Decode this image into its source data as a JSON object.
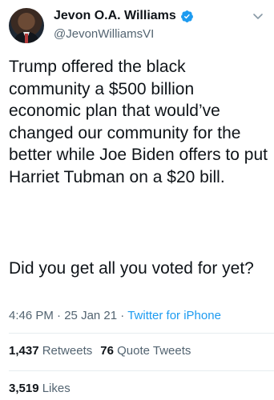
{
  "author": {
    "name": "Jevon O.A. Williams",
    "handle": "@JevonWilliamsVI",
    "verified": true,
    "verified_color": "#1d9bf0"
  },
  "tweet": {
    "paragraph1": "Trump offered the black community a $500 billion economic plan that would’ve changed our community for the better while Joe Biden offers to put Harriet Tubman on a $20 bill.",
    "paragraph2": "Did you get all you voted for yet?"
  },
  "meta": {
    "time": "4:46 PM",
    "separator1": "·",
    "date": "25 Jan 21",
    "separator2": "·",
    "source": "Twitter for iPhone"
  },
  "stats": {
    "retweets_count": "1,437",
    "retweets_label": "Retweets",
    "quote_tweets_count": "76",
    "quote_tweets_label": "Quote Tweets",
    "likes_count": "3,519",
    "likes_label": "Likes"
  },
  "icons": {
    "verified": "verified-badge-icon",
    "more": "chevron-down-icon"
  },
  "colors": {
    "text": "#0f1419",
    "secondary": "#536471",
    "link": "#1d9bf0"
  }
}
